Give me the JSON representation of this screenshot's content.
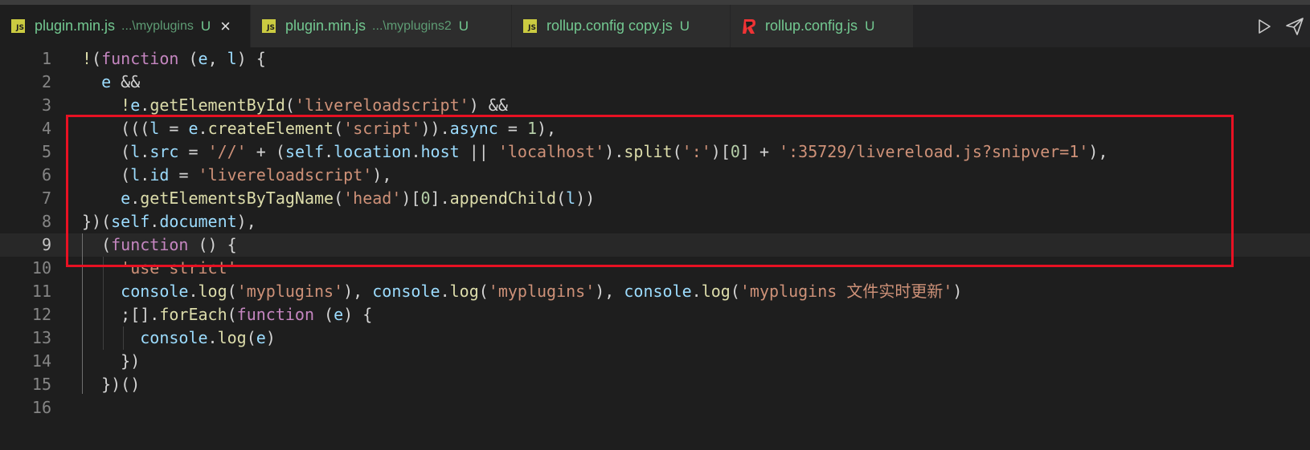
{
  "tabs": [
    {
      "name": "plugin.min.js",
      "path": "...\\myplugins",
      "status": "U",
      "close": "×",
      "active": true,
      "icon": "js-icon"
    },
    {
      "name": "plugin.min.js",
      "path": "...\\myplugins2",
      "status": "U",
      "active": false,
      "icon": "js-icon"
    },
    {
      "name": "rollup.config copy.js",
      "path": "",
      "status": "U",
      "active": false,
      "icon": "js-icon"
    },
    {
      "name": "rollup.config.js",
      "path": "",
      "status": "U",
      "active": false,
      "icon": "rollup-icon"
    }
  ],
  "js_icon_text": "JS",
  "actions": [
    {
      "icon": "run-icon"
    },
    {
      "icon": "send-icon"
    }
  ],
  "editor": {
    "current_line": 9,
    "highlight_color": "#e81123",
    "lines": [
      {
        "n": "1",
        "tokens": [
          [
            "!",
            "fn"
          ],
          [
            "(",
            "pun"
          ],
          [
            "function",
            "kw"
          ],
          [
            " (",
            "pun"
          ],
          [
            "e",
            "var"
          ],
          [
            ", ",
            "pun"
          ],
          [
            "l",
            "var"
          ],
          [
            ") {",
            "pun"
          ]
        ]
      },
      {
        "n": "2",
        "tokens": [
          [
            "  ",
            "pun"
          ],
          [
            "e",
            "var"
          ],
          [
            " &&",
            "op"
          ]
        ]
      },
      {
        "n": "3",
        "tokens": [
          [
            "    ",
            "pun"
          ],
          [
            "!",
            "fn"
          ],
          [
            "e",
            "var"
          ],
          [
            ".",
            "pun"
          ],
          [
            "getElementById",
            "fn"
          ],
          [
            "(",
            "pun"
          ],
          [
            "'livereloadscript'",
            "str"
          ],
          [
            ") ",
            "pun"
          ],
          [
            "&&",
            "op"
          ]
        ]
      },
      {
        "n": "4",
        "tokens": [
          [
            "    (((",
            "pun"
          ],
          [
            "l",
            "var"
          ],
          [
            " = ",
            "op"
          ],
          [
            "e",
            "var"
          ],
          [
            ".",
            "pun"
          ],
          [
            "createElement",
            "fn"
          ],
          [
            "(",
            "pun"
          ],
          [
            "'script'",
            "str"
          ],
          [
            ")).",
            "pun"
          ],
          [
            "async",
            "var"
          ],
          [
            " = ",
            "op"
          ],
          [
            "1",
            "num"
          ],
          [
            "),",
            "pun"
          ]
        ]
      },
      {
        "n": "5",
        "tokens": [
          [
            "    (",
            "pun"
          ],
          [
            "l",
            "var"
          ],
          [
            ".",
            "pun"
          ],
          [
            "src",
            "var"
          ],
          [
            " = ",
            "op"
          ],
          [
            "'//'",
            "str"
          ],
          [
            " + (",
            "op"
          ],
          [
            "self",
            "var"
          ],
          [
            ".",
            "pun"
          ],
          [
            "location",
            "var"
          ],
          [
            ".",
            "pun"
          ],
          [
            "host",
            "var"
          ],
          [
            " || ",
            "op"
          ],
          [
            "'localhost'",
            "str"
          ],
          [
            ").",
            "pun"
          ],
          [
            "split",
            "fn"
          ],
          [
            "(",
            "pun"
          ],
          [
            "':'",
            "str"
          ],
          [
            ")[",
            "pun"
          ],
          [
            "0",
            "num"
          ],
          [
            "] + ",
            "op"
          ],
          [
            "':35729/livereload.js?snipver=1'",
            "str"
          ],
          [
            "),",
            "pun"
          ]
        ]
      },
      {
        "n": "6",
        "tokens": [
          [
            "    (",
            "pun"
          ],
          [
            "l",
            "var"
          ],
          [
            ".",
            "pun"
          ],
          [
            "id",
            "var"
          ],
          [
            " = ",
            "op"
          ],
          [
            "'livereloadscript'",
            "str"
          ],
          [
            "),",
            "pun"
          ]
        ]
      },
      {
        "n": "7",
        "tokens": [
          [
            "    ",
            "pun"
          ],
          [
            "e",
            "var"
          ],
          [
            ".",
            "pun"
          ],
          [
            "getElementsByTagName",
            "fn"
          ],
          [
            "(",
            "pun"
          ],
          [
            "'head'",
            "str"
          ],
          [
            ")[",
            "pun"
          ],
          [
            "0",
            "num"
          ],
          [
            "].",
            "pun"
          ],
          [
            "appendChild",
            "fn"
          ],
          [
            "(",
            "pun"
          ],
          [
            "l",
            "var"
          ],
          [
            "))",
            "pun"
          ]
        ]
      },
      {
        "n": "8",
        "tokens": [
          [
            "})(",
            "pun"
          ],
          [
            "self",
            "var"
          ],
          [
            ".",
            "pun"
          ],
          [
            "document",
            "var"
          ],
          [
            "),",
            "pun"
          ]
        ]
      },
      {
        "n": "9",
        "tokens": [
          [
            "  (",
            "pun"
          ],
          [
            "function",
            "kw"
          ],
          [
            " () {",
            "pun"
          ]
        ]
      },
      {
        "n": "10",
        "tokens": [
          [
            "    ",
            "pun"
          ],
          [
            "'use strict'",
            "str"
          ]
        ]
      },
      {
        "n": "11",
        "tokens": [
          [
            "    ",
            "pun"
          ],
          [
            "console",
            "var"
          ],
          [
            ".",
            "pun"
          ],
          [
            "log",
            "fn"
          ],
          [
            "(",
            "pun"
          ],
          [
            "'myplugins'",
            "str"
          ],
          [
            "), ",
            "pun"
          ],
          [
            "console",
            "var"
          ],
          [
            ".",
            "pun"
          ],
          [
            "log",
            "fn"
          ],
          [
            "(",
            "pun"
          ],
          [
            "'myplugins'",
            "str"
          ],
          [
            "), ",
            "pun"
          ],
          [
            "console",
            "var"
          ],
          [
            ".",
            "pun"
          ],
          [
            "log",
            "fn"
          ],
          [
            "(",
            "pun"
          ],
          [
            "'myplugins 文件实时更新'",
            "str"
          ],
          [
            ")",
            "pun"
          ]
        ]
      },
      {
        "n": "12",
        "tokens": [
          [
            "    ;[].",
            "pun"
          ],
          [
            "forEach",
            "fn"
          ],
          [
            "(",
            "pun"
          ],
          [
            "function",
            "kw"
          ],
          [
            " (",
            "pun"
          ],
          [
            "e",
            "var"
          ],
          [
            ") {",
            "pun"
          ]
        ]
      },
      {
        "n": "13",
        "tokens": [
          [
            "      ",
            "pun"
          ],
          [
            "console",
            "var"
          ],
          [
            ".",
            "pun"
          ],
          [
            "log",
            "fn"
          ],
          [
            "(",
            "pun"
          ],
          [
            "e",
            "var"
          ],
          [
            ")",
            "pun"
          ]
        ]
      },
      {
        "n": "14",
        "tokens": [
          [
            "    })",
            "pun"
          ]
        ]
      },
      {
        "n": "15",
        "tokens": [
          [
            "  })()",
            "pun"
          ]
        ]
      },
      {
        "n": "16",
        "tokens": []
      }
    ]
  }
}
